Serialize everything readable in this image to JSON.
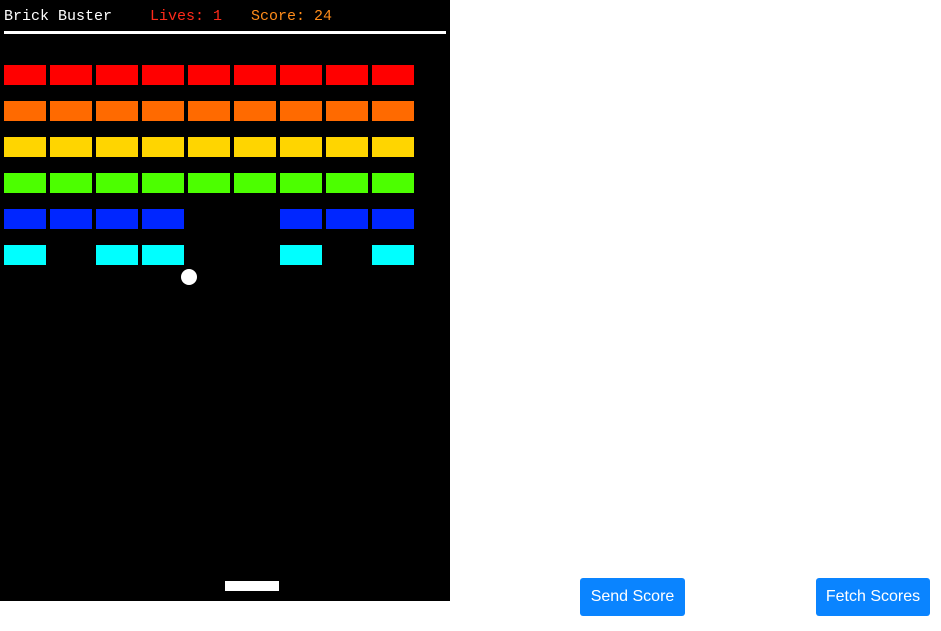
{
  "hud": {
    "title": "Brick Buster",
    "lives_text": "Lives: 1",
    "score_text": "Score: 24"
  },
  "colors": {
    "background": "#000000",
    "title": "#ffffff",
    "lives": "#ff2a1a",
    "score": "#ff8c1a",
    "divider": "#ffffff",
    "ball": "#ffffff",
    "paddle": "#ffffff",
    "button": "#0a84ff",
    "button_text": "#ffffff"
  },
  "brick_rows": [
    {
      "color": "#ff0000",
      "present": [
        1,
        1,
        1,
        1,
        1,
        1,
        1,
        1,
        1
      ]
    },
    {
      "color": "#ff6a00",
      "present": [
        1,
        1,
        1,
        1,
        1,
        1,
        1,
        1,
        1
      ]
    },
    {
      "color": "#ffd500",
      "present": [
        1,
        1,
        1,
        1,
        1,
        1,
        1,
        1,
        1
      ]
    },
    {
      "color": "#4cff00",
      "present": [
        1,
        1,
        1,
        1,
        1,
        1,
        1,
        1,
        1
      ]
    },
    {
      "color": "#0026ff",
      "present": [
        1,
        1,
        1,
        1,
        0,
        0,
        1,
        1,
        1
      ]
    },
    {
      "color": "#00ffff",
      "present": [
        1,
        0,
        1,
        1,
        0,
        0,
        1,
        0,
        1
      ]
    }
  ],
  "actions": {
    "send_score_label": "Send Score",
    "fetch_scores_label": "Fetch Scores"
  }
}
